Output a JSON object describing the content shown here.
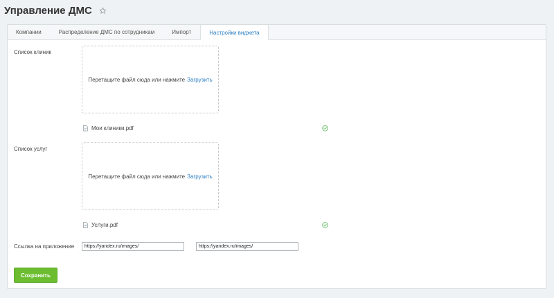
{
  "header": {
    "title": "Управление ДМС"
  },
  "tabs": [
    {
      "label": "Компании",
      "active": false
    },
    {
      "label": "Распределение ДМС по сотрудникам",
      "active": false
    },
    {
      "label": "Импорт",
      "active": false
    },
    {
      "label": "Настройки виджета",
      "active": true
    }
  ],
  "clinics": {
    "label": "Список клиник",
    "dropzone_text": "Перетащите файл сюда или нажмите",
    "dropzone_link": "Загрузить",
    "file_name": "Мои клиники.pdf",
    "status_icon": "check-circle"
  },
  "services": {
    "label": "Список услуг",
    "dropzone_text": "Перетащите файл сюда или нажмите",
    "dropzone_link": "Загрузить",
    "file_name": "Услуги.pdf",
    "status_icon": "check-circle"
  },
  "app_link": {
    "label": "Ссылка на приложение",
    "input_1_value": "https://yandex.ru/images/",
    "input_2_value": "https://yandex.ru/images/"
  },
  "actions": {
    "save_label": "Сохранить"
  },
  "colors": {
    "accent_link": "#2f80c5",
    "success_green": "#6bbd2f",
    "check_green": "#5cb85c"
  }
}
